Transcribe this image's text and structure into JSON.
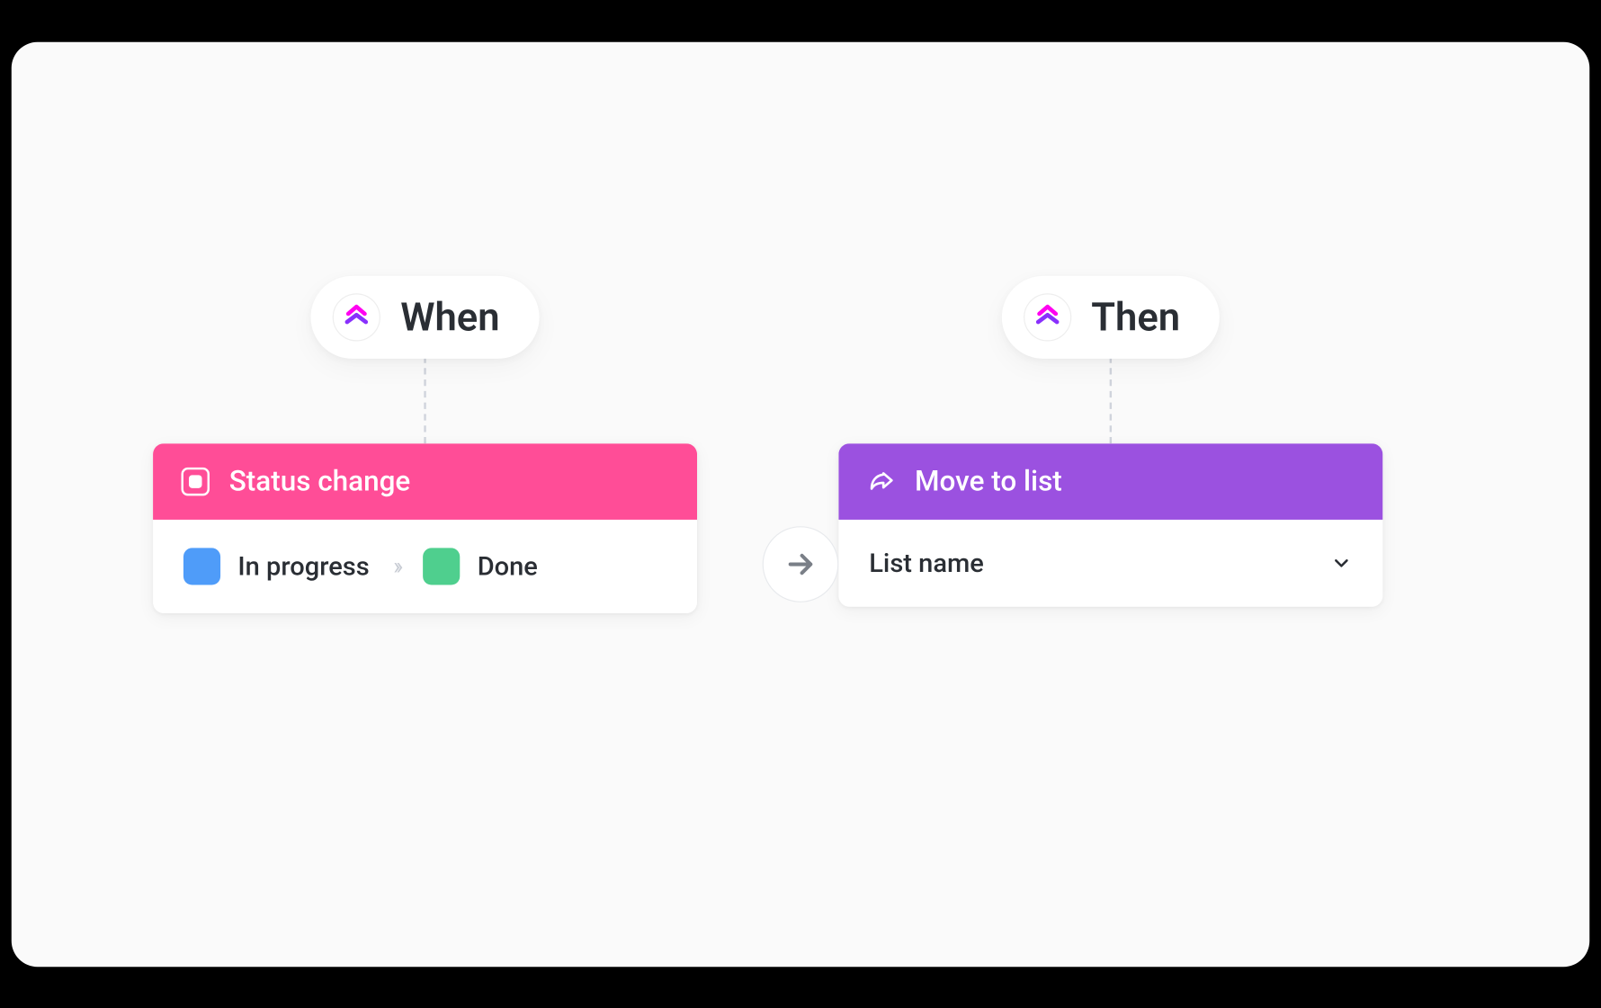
{
  "trigger": {
    "pill_label": "When",
    "card_title": "Status change",
    "status_from": "In progress",
    "status_to": "Done",
    "colors": {
      "header": "#ff4d97",
      "swatch_from": "#4f9cf9",
      "swatch_to": "#4fcf8e"
    }
  },
  "action": {
    "pill_label": "Then",
    "card_title": "Move to list",
    "dropdown_label": "List name",
    "colors": {
      "header": "#9b51e0"
    }
  }
}
